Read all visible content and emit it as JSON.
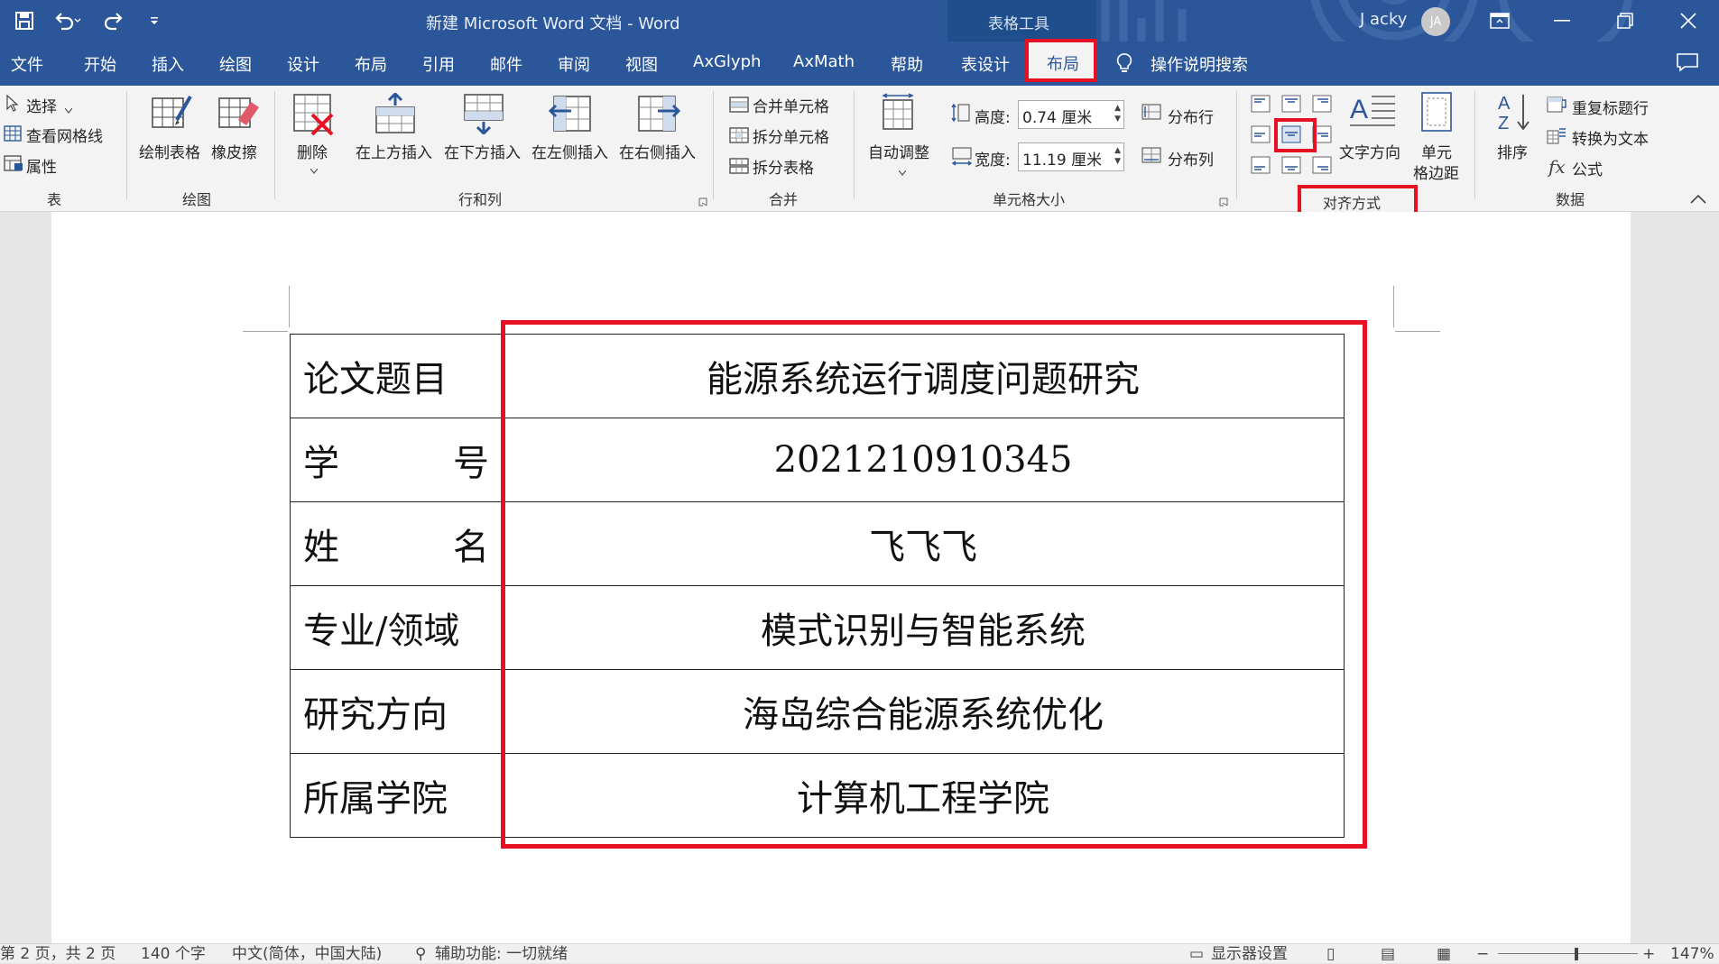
{
  "titlebar": {
    "doc_title": "新建 Microsoft Word 文档  -  Word",
    "tools_label": "表格工具",
    "user_name": "J acky",
    "avatar_initials": "JA"
  },
  "tabs": {
    "file": "文件",
    "home": "开始",
    "insert": "插入",
    "draw": "绘图",
    "design": "设计",
    "layout_page": "布局",
    "references": "引用",
    "mailings": "邮件",
    "review": "审阅",
    "view": "视图",
    "axglyph": "AxGlyph",
    "axmath": "AxMath",
    "help": "帮助",
    "table_design": "表设计",
    "table_layout": "布局",
    "tell_me": "操作说明搜索"
  },
  "ribbon": {
    "table": {
      "select": "选择",
      "gridlines": "查看网格线",
      "properties": "属性",
      "label": "表"
    },
    "draw": {
      "draw_table": "绘制表格",
      "eraser": "橡皮擦",
      "label": "绘图"
    },
    "rows_cols": {
      "delete": "删除",
      "insert_above": "在上方插入",
      "insert_below": "在下方插入",
      "insert_left": "在左侧插入",
      "insert_right": "在右侧插入",
      "label": "行和列"
    },
    "merge": {
      "merge_cells": "合并单元格",
      "split_cells": "拆分单元格",
      "split_table": "拆分表格",
      "label": "合并"
    },
    "cell_size": {
      "autofit": "自动调整",
      "height_label": "高度:",
      "height_value": "0.74 厘米",
      "width_label": "宽度:",
      "width_value": "11.19 厘米",
      "distribute_rows": "分布行",
      "distribute_cols": "分布列",
      "label": "单元格大小"
    },
    "alignment": {
      "text_direction": "文字方向",
      "cell_margins_1": "单元",
      "cell_margins_2": "格边距",
      "label": "对齐方式"
    },
    "data": {
      "sort": "排序",
      "repeat_header": "重复标题行",
      "convert_text": "转换为文本",
      "formula": "公式",
      "label": "数据"
    }
  },
  "table_rows": [
    {
      "label": "论文题目",
      "value": "能源系统运行调度问题研究",
      "justify": false
    },
    {
      "label": "学号",
      "label_a": "学",
      "label_b": "号",
      "value": "2021210910345",
      "justify": true
    },
    {
      "label": "姓名",
      "label_a": "姓",
      "label_b": "名",
      "value": "飞飞飞",
      "justify": true
    },
    {
      "label": "专业/领域",
      "value": "模式识别与智能系统",
      "justify": false
    },
    {
      "label": "研究方向",
      "value": "海岛综合能源系统优化",
      "justify": false
    },
    {
      "label": "所属学院",
      "value": "计算机工程学院",
      "justify": false
    }
  ],
  "statusbar": {
    "page": "第 2 页，共 2 页",
    "words": "140 个字",
    "language": "中文(简体，中国大陆)",
    "accessibility": "辅助功能: 一切就绪",
    "display_settings": "显示器设置",
    "zoom": "147%"
  },
  "colors": {
    "brand": "#2b579a",
    "highlight": "#e81123",
    "ribbon_bg": "#f3f3f3"
  }
}
